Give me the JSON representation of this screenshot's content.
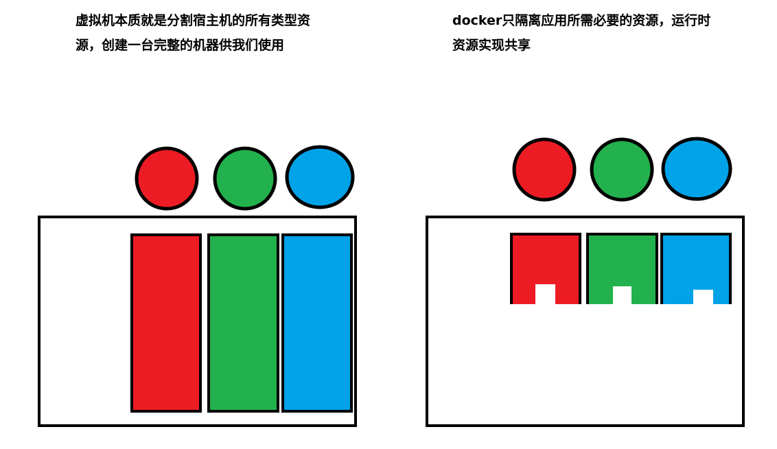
{
  "captions": {
    "vm_line1": "虚拟机本质就是分割宿主机的所有类型资",
    "vm_line2": "源，创建一台完整的机器供我们使用",
    "docker_line1": "docker只隔离应用所需必要的资源，运行时",
    "docker_line2": "资源实现共享"
  },
  "colors": {
    "red": "#ED1C24",
    "green": "#22B14C",
    "blue": "#00A2E8",
    "outline": "#000000",
    "background": "#FFFFFF"
  }
}
